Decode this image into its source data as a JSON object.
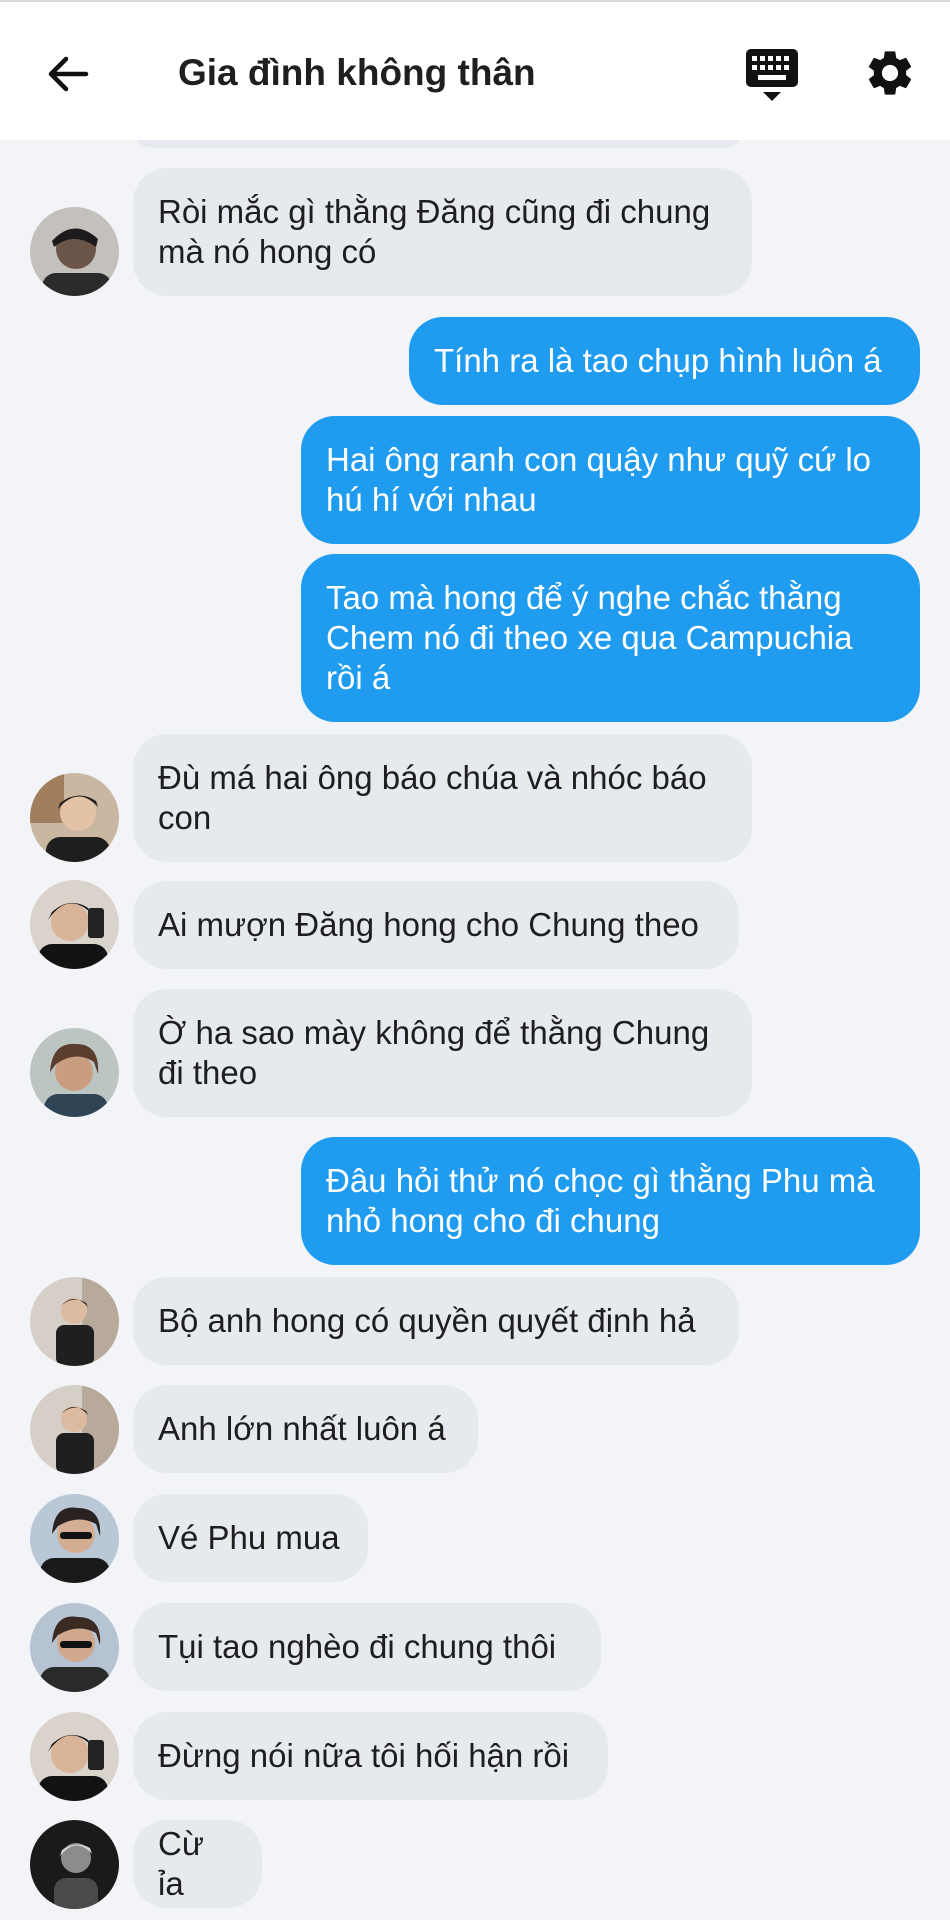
{
  "header": {
    "title": "Gia đình không thân",
    "back_icon": "arrow-left-icon",
    "keyboard_icon": "keyboard-icon",
    "settings_icon": "gear-icon"
  },
  "colors": {
    "outgoing_bubble": "#1f9cef",
    "incoming_bubble": "#e6e9ed",
    "chat_background": "#f3f4f7"
  },
  "messages": [
    {
      "direction": "in",
      "text": "Ròi mắc gì thằng Đăng cũng đi chung mà nó hong có"
    },
    {
      "direction": "out",
      "text": "Tính ra là tao chụp hình luôn á"
    },
    {
      "direction": "out",
      "text": "Hai ông ranh con quậy như quỹ cứ lo hú hí với nhau"
    },
    {
      "direction": "out",
      "text": "Tao mà hong để ý nghe chắc thằng Chem nó đi theo xe qua Campuchia rồi á"
    },
    {
      "direction": "in",
      "text": "Đù má hai ông báo chúa và nhóc báo con"
    },
    {
      "direction": "in",
      "text": "Ai mượn Đăng hong cho Chung theo"
    },
    {
      "direction": "in",
      "text": "Ờ ha sao mày không để thằng Chung đi theo"
    },
    {
      "direction": "out",
      "text": "Đâu hỏi thử nó chọc gì thằng Phu mà nhỏ hong cho đi chung"
    },
    {
      "direction": "in",
      "text": "Bộ anh hong có quyền quyết định hả"
    },
    {
      "direction": "in",
      "text": "Anh lớn nhất luôn á"
    },
    {
      "direction": "in",
      "text": "Vé Phu mua"
    },
    {
      "direction": "in",
      "text": "Tụi tao nghèo đi chung thôi"
    },
    {
      "direction": "in",
      "text": "Đừng nói nữa tôi hối hận rồi"
    },
    {
      "direction": "in",
      "text": "Cừ ỉa"
    }
  ]
}
